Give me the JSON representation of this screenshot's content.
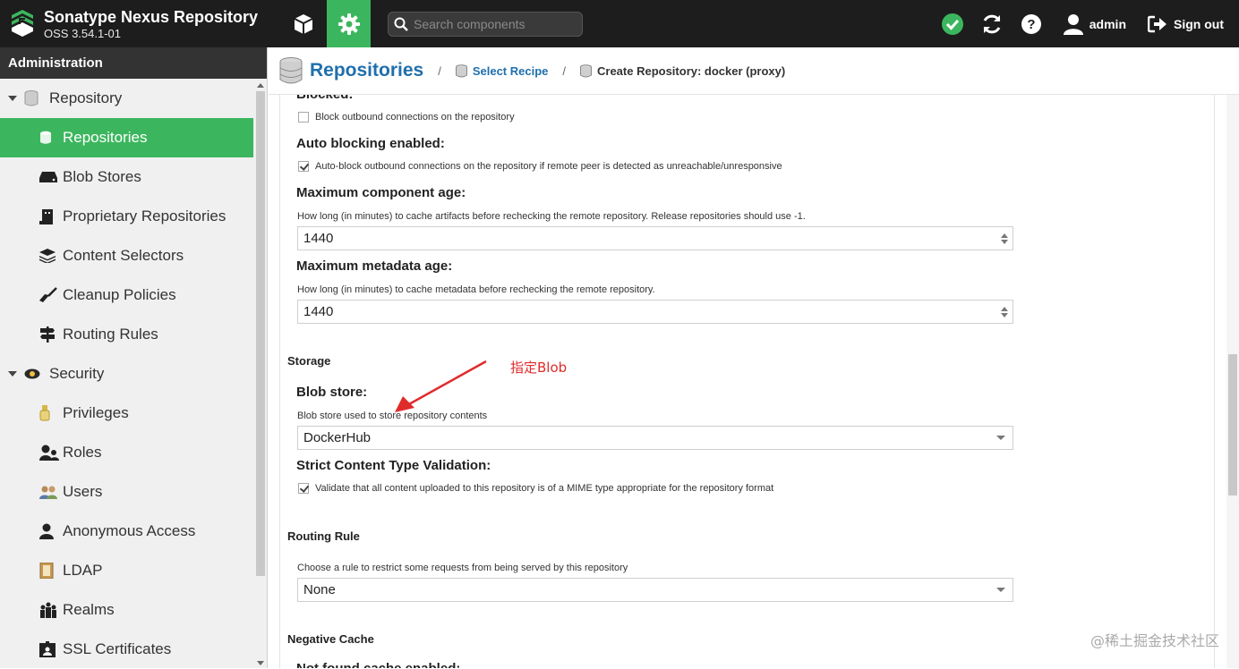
{
  "header": {
    "title": "Sonatype Nexus Repository",
    "version": "OSS 3.54.1-01",
    "search_placeholder": "Search components",
    "user": "admin",
    "signout": "Sign out"
  },
  "sidebar": {
    "title": "Administration",
    "groups": [
      {
        "label": "Repository",
        "items": [
          {
            "label": "Repositories",
            "active": true
          },
          {
            "label": "Blob Stores"
          },
          {
            "label": "Proprietary Repositories"
          },
          {
            "label": "Content Selectors"
          },
          {
            "label": "Cleanup Policies"
          },
          {
            "label": "Routing Rules"
          }
        ]
      },
      {
        "label": "Security",
        "items": [
          {
            "label": "Privileges"
          },
          {
            "label": "Roles"
          },
          {
            "label": "Users"
          },
          {
            "label": "Anonymous Access"
          },
          {
            "label": "LDAP"
          },
          {
            "label": "Realms"
          },
          {
            "label": "SSL Certificates"
          }
        ]
      }
    ]
  },
  "breadcrumb": {
    "title": "Repositories",
    "sep": "/",
    "step1": "Select Recipe",
    "step2": "Create Repository: docker (proxy)"
  },
  "form": {
    "blocked_label": "Blocked:",
    "blocked_cb": "Block outbound connections on the repository",
    "autoblock_label": "Auto blocking enabled:",
    "autoblock_cb": "Auto-block outbound connections on the repository if remote peer is detected as unreachable/unresponsive",
    "max_component_age_label": "Maximum component age:",
    "max_component_age_help": "How long (in minutes) to cache artifacts before rechecking the remote repository. Release repositories should use -1.",
    "max_component_age_value": "1440",
    "max_metadata_age_label": "Maximum metadata age:",
    "max_metadata_age_help": "How long (in minutes) to cache metadata before rechecking the remote repository.",
    "max_metadata_age_value": "1440",
    "storage_title": "Storage",
    "blob_store_label": "Blob store:",
    "blob_store_help": "Blob store used to store repository contents",
    "blob_store_value": "DockerHub",
    "strict_label": "Strict Content Type Validation:",
    "strict_cb": "Validate that all content uploaded to this repository is of a MIME type appropriate for the repository format",
    "routing_title": "Routing Rule",
    "routing_help": "Choose a rule to restrict some requests from being served by this repository",
    "routing_value": "None",
    "negative_cache_title": "Negative Cache",
    "not_found_label": "Not found cache enabled:"
  },
  "annotation": "指定Blob",
  "watermark": "@稀土掘金技术社区",
  "colors": {
    "accent": "#3cb65e",
    "link": "#1f6fad",
    "header": "#1d1d1d",
    "annotation": "#e02b2b"
  }
}
